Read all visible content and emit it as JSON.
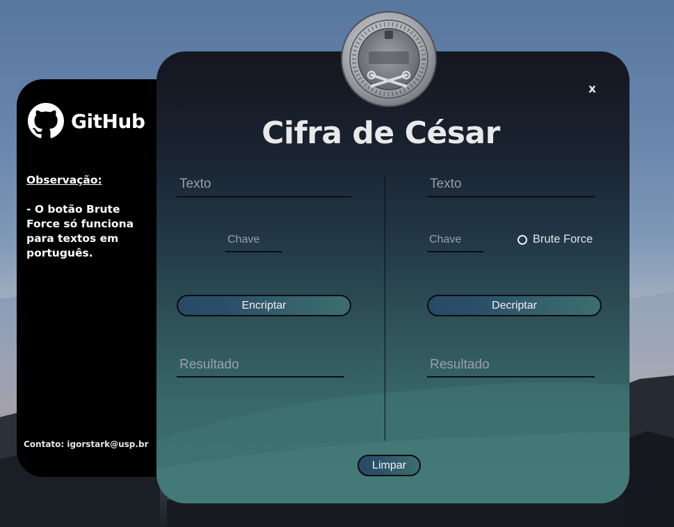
{
  "sidebar": {
    "brand": "GitHub",
    "observation_title": "Observação:",
    "observation_text": "- O botão Brute Force só funciona para textos em português.",
    "contact": "Contato: igorstark@usp.br"
  },
  "header": {
    "title": "Cifra de César",
    "close_label": "x",
    "logo_icon": "caesar-cipher-decoder-coin"
  },
  "encrypt": {
    "text_placeholder": "Texto",
    "key_placeholder": "Chave",
    "button_label": "Encriptar",
    "result_placeholder": "Resultado"
  },
  "decrypt": {
    "text_placeholder": "Texto",
    "key_placeholder": "Chave",
    "brute_force_label": "Brute Force",
    "brute_force_checked": false,
    "button_label": "Decriptar",
    "result_placeholder": "Resultado"
  },
  "footer": {
    "clear_label": "Limpar"
  },
  "colors": {
    "sidebar_bg": "#000000",
    "panel_top": "#15161f",
    "panel_bottom": "#3f7372",
    "button_gradient_start": "#274a66",
    "button_gradient_end": "#3c6e6e",
    "title_text": "#e9e9e9",
    "placeholder_text": "#9aa0a8"
  }
}
